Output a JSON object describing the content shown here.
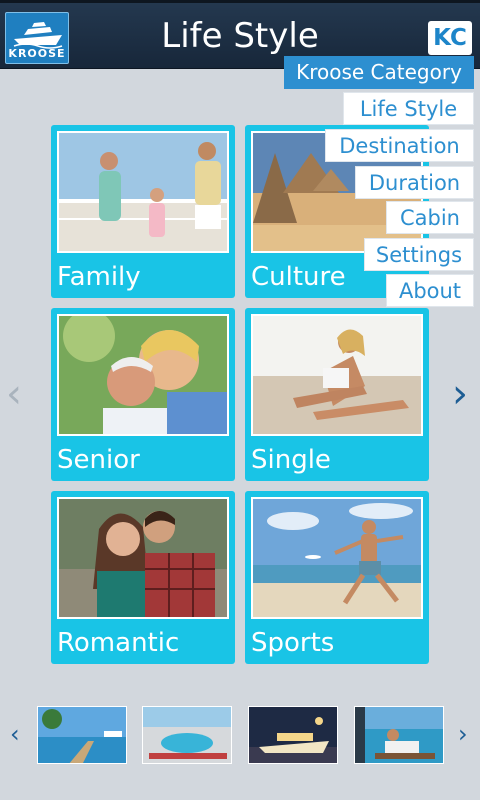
{
  "header": {
    "logo_text": "KROOSE",
    "title": "Life Style",
    "badge": "KC"
  },
  "menu": {
    "heading": "Kroose Category",
    "items": [
      "Life Style",
      "Destination",
      "Duration",
      "Cabin",
      "Settings",
      "About"
    ]
  },
  "categories": [
    {
      "label": "Family",
      "icon": "family-photo"
    },
    {
      "label": "Culture",
      "icon": "culture-photo"
    },
    {
      "label": "Senior",
      "icon": "senior-photo"
    },
    {
      "label": "Single",
      "icon": "single-photo"
    },
    {
      "label": "Romantic",
      "icon": "romantic-photo"
    },
    {
      "label": "Sports",
      "icon": "sports-photo"
    }
  ],
  "colors": {
    "accent": "#19c4e6",
    "menu_blue": "#2d8fd0",
    "header": "#1c2f45",
    "background": "#d2d7dd"
  }
}
